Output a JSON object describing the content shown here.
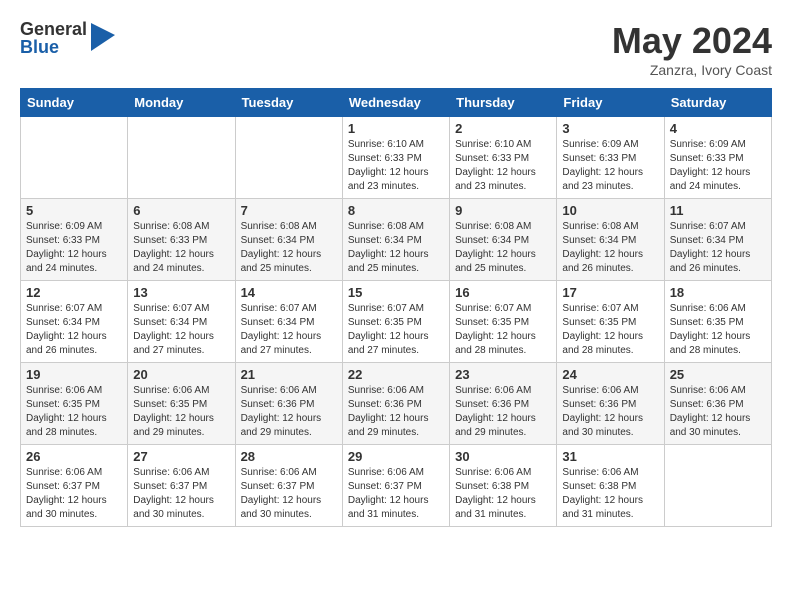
{
  "logo": {
    "general": "General",
    "blue": "Blue"
  },
  "title": {
    "month_year": "May 2024",
    "location": "Zanzra, Ivory Coast"
  },
  "weekdays": [
    "Sunday",
    "Monday",
    "Tuesday",
    "Wednesday",
    "Thursday",
    "Friday",
    "Saturday"
  ],
  "weeks": [
    [
      {
        "day": "",
        "info": ""
      },
      {
        "day": "",
        "info": ""
      },
      {
        "day": "",
        "info": ""
      },
      {
        "day": "1",
        "info": "Sunrise: 6:10 AM\nSunset: 6:33 PM\nDaylight: 12 hours\nand 23 minutes."
      },
      {
        "day": "2",
        "info": "Sunrise: 6:10 AM\nSunset: 6:33 PM\nDaylight: 12 hours\nand 23 minutes."
      },
      {
        "day": "3",
        "info": "Sunrise: 6:09 AM\nSunset: 6:33 PM\nDaylight: 12 hours\nand 23 minutes."
      },
      {
        "day": "4",
        "info": "Sunrise: 6:09 AM\nSunset: 6:33 PM\nDaylight: 12 hours\nand 24 minutes."
      }
    ],
    [
      {
        "day": "5",
        "info": "Sunrise: 6:09 AM\nSunset: 6:33 PM\nDaylight: 12 hours\nand 24 minutes."
      },
      {
        "day": "6",
        "info": "Sunrise: 6:08 AM\nSunset: 6:33 PM\nDaylight: 12 hours\nand 24 minutes."
      },
      {
        "day": "7",
        "info": "Sunrise: 6:08 AM\nSunset: 6:34 PM\nDaylight: 12 hours\nand 25 minutes."
      },
      {
        "day": "8",
        "info": "Sunrise: 6:08 AM\nSunset: 6:34 PM\nDaylight: 12 hours\nand 25 minutes."
      },
      {
        "day": "9",
        "info": "Sunrise: 6:08 AM\nSunset: 6:34 PM\nDaylight: 12 hours\nand 25 minutes."
      },
      {
        "day": "10",
        "info": "Sunrise: 6:08 AM\nSunset: 6:34 PM\nDaylight: 12 hours\nand 26 minutes."
      },
      {
        "day": "11",
        "info": "Sunrise: 6:07 AM\nSunset: 6:34 PM\nDaylight: 12 hours\nand 26 minutes."
      }
    ],
    [
      {
        "day": "12",
        "info": "Sunrise: 6:07 AM\nSunset: 6:34 PM\nDaylight: 12 hours\nand 26 minutes."
      },
      {
        "day": "13",
        "info": "Sunrise: 6:07 AM\nSunset: 6:34 PM\nDaylight: 12 hours\nand 27 minutes."
      },
      {
        "day": "14",
        "info": "Sunrise: 6:07 AM\nSunset: 6:34 PM\nDaylight: 12 hours\nand 27 minutes."
      },
      {
        "day": "15",
        "info": "Sunrise: 6:07 AM\nSunset: 6:35 PM\nDaylight: 12 hours\nand 27 minutes."
      },
      {
        "day": "16",
        "info": "Sunrise: 6:07 AM\nSunset: 6:35 PM\nDaylight: 12 hours\nand 28 minutes."
      },
      {
        "day": "17",
        "info": "Sunrise: 6:07 AM\nSunset: 6:35 PM\nDaylight: 12 hours\nand 28 minutes."
      },
      {
        "day": "18",
        "info": "Sunrise: 6:06 AM\nSunset: 6:35 PM\nDaylight: 12 hours\nand 28 minutes."
      }
    ],
    [
      {
        "day": "19",
        "info": "Sunrise: 6:06 AM\nSunset: 6:35 PM\nDaylight: 12 hours\nand 28 minutes."
      },
      {
        "day": "20",
        "info": "Sunrise: 6:06 AM\nSunset: 6:35 PM\nDaylight: 12 hours\nand 29 minutes."
      },
      {
        "day": "21",
        "info": "Sunrise: 6:06 AM\nSunset: 6:36 PM\nDaylight: 12 hours\nand 29 minutes."
      },
      {
        "day": "22",
        "info": "Sunrise: 6:06 AM\nSunset: 6:36 PM\nDaylight: 12 hours\nand 29 minutes."
      },
      {
        "day": "23",
        "info": "Sunrise: 6:06 AM\nSunset: 6:36 PM\nDaylight: 12 hours\nand 29 minutes."
      },
      {
        "day": "24",
        "info": "Sunrise: 6:06 AM\nSunset: 6:36 PM\nDaylight: 12 hours\nand 30 minutes."
      },
      {
        "day": "25",
        "info": "Sunrise: 6:06 AM\nSunset: 6:36 PM\nDaylight: 12 hours\nand 30 minutes."
      }
    ],
    [
      {
        "day": "26",
        "info": "Sunrise: 6:06 AM\nSunset: 6:37 PM\nDaylight: 12 hours\nand 30 minutes."
      },
      {
        "day": "27",
        "info": "Sunrise: 6:06 AM\nSunset: 6:37 PM\nDaylight: 12 hours\nand 30 minutes."
      },
      {
        "day": "28",
        "info": "Sunrise: 6:06 AM\nSunset: 6:37 PM\nDaylight: 12 hours\nand 30 minutes."
      },
      {
        "day": "29",
        "info": "Sunrise: 6:06 AM\nSunset: 6:37 PM\nDaylight: 12 hours\nand 31 minutes."
      },
      {
        "day": "30",
        "info": "Sunrise: 6:06 AM\nSunset: 6:38 PM\nDaylight: 12 hours\nand 31 minutes."
      },
      {
        "day": "31",
        "info": "Sunrise: 6:06 AM\nSunset: 6:38 PM\nDaylight: 12 hours\nand 31 minutes."
      },
      {
        "day": "",
        "info": ""
      }
    ]
  ]
}
